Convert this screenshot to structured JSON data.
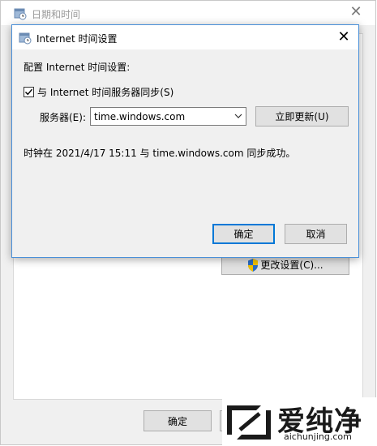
{
  "parent_window": {
    "title": "日期和时间",
    "close_glyph": "✕",
    "change_settings_label": "更改设置(C)...",
    "ok_label": "确定",
    "partial_button_label": ""
  },
  "dialog": {
    "title": "Internet 时间设置",
    "close_glyph": "✕",
    "config_label": "配置 Internet 时间设置:",
    "sync_checkbox": {
      "label": "与 Internet 时间服务器同步(S)",
      "checked": true
    },
    "server_label": "服务器(E):",
    "server_value": "time.windows.com",
    "update_now_label": "立即更新(U)",
    "status_text": "时钟在 2021/4/17 15:11 与 time.windows.com 同步成功。",
    "ok_label": "确定",
    "cancel_label": "取消"
  },
  "watermark": {
    "brand_cn": "爱纯净",
    "url": "aichunjing.com"
  },
  "colors": {
    "accent": "#0078d7",
    "window_bg": "#f0f0f0",
    "button_bg": "#e1e1e1",
    "shield_blue": "#2b6cc4",
    "shield_yellow": "#f2c200"
  },
  "icons": {
    "parent_icon": "date-time-icon",
    "dialog_icon": "internet-time-icon",
    "shield": "uac-shield-icon",
    "combo": "chevron-down-icon"
  }
}
